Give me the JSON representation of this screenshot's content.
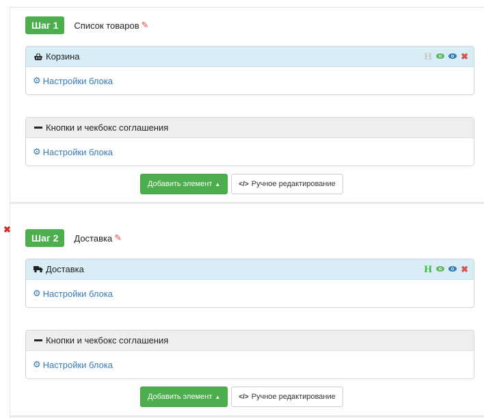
{
  "colors": {
    "accent_green": "#4cae4c",
    "link_blue": "#337ab7",
    "danger_red": "#d9534f",
    "panel_blue": "#d9edf7",
    "panel_gray": "#eeeeee"
  },
  "steps": [
    {
      "badge": "Шаг 1",
      "title": "Список товаров",
      "panels": [
        {
          "label": "Корзина",
          "icon": "basket-icon",
          "h_active": false,
          "settings": "Настройки блока"
        },
        {
          "label": "Кнопки и чекбокс соглашения",
          "icon": "minus-icon",
          "settings": "Настройки блока"
        }
      ],
      "add_button": "Добавить элемент",
      "manual_button": "Ручное редактирование"
    },
    {
      "badge": "Шаг 2",
      "title": "Доставка",
      "panels": [
        {
          "label": "Доставка",
          "icon": "truck-icon",
          "h_active": true,
          "settings": "Настройки блока"
        },
        {
          "label": "Кнопки и чекбокс соглашения",
          "icon": "minus-icon",
          "settings": "Настройки блока"
        }
      ],
      "add_button": "Добавить элемент",
      "manual_button": "Ручное редактирование"
    }
  ],
  "panel_actions": {
    "h_label": "H"
  }
}
